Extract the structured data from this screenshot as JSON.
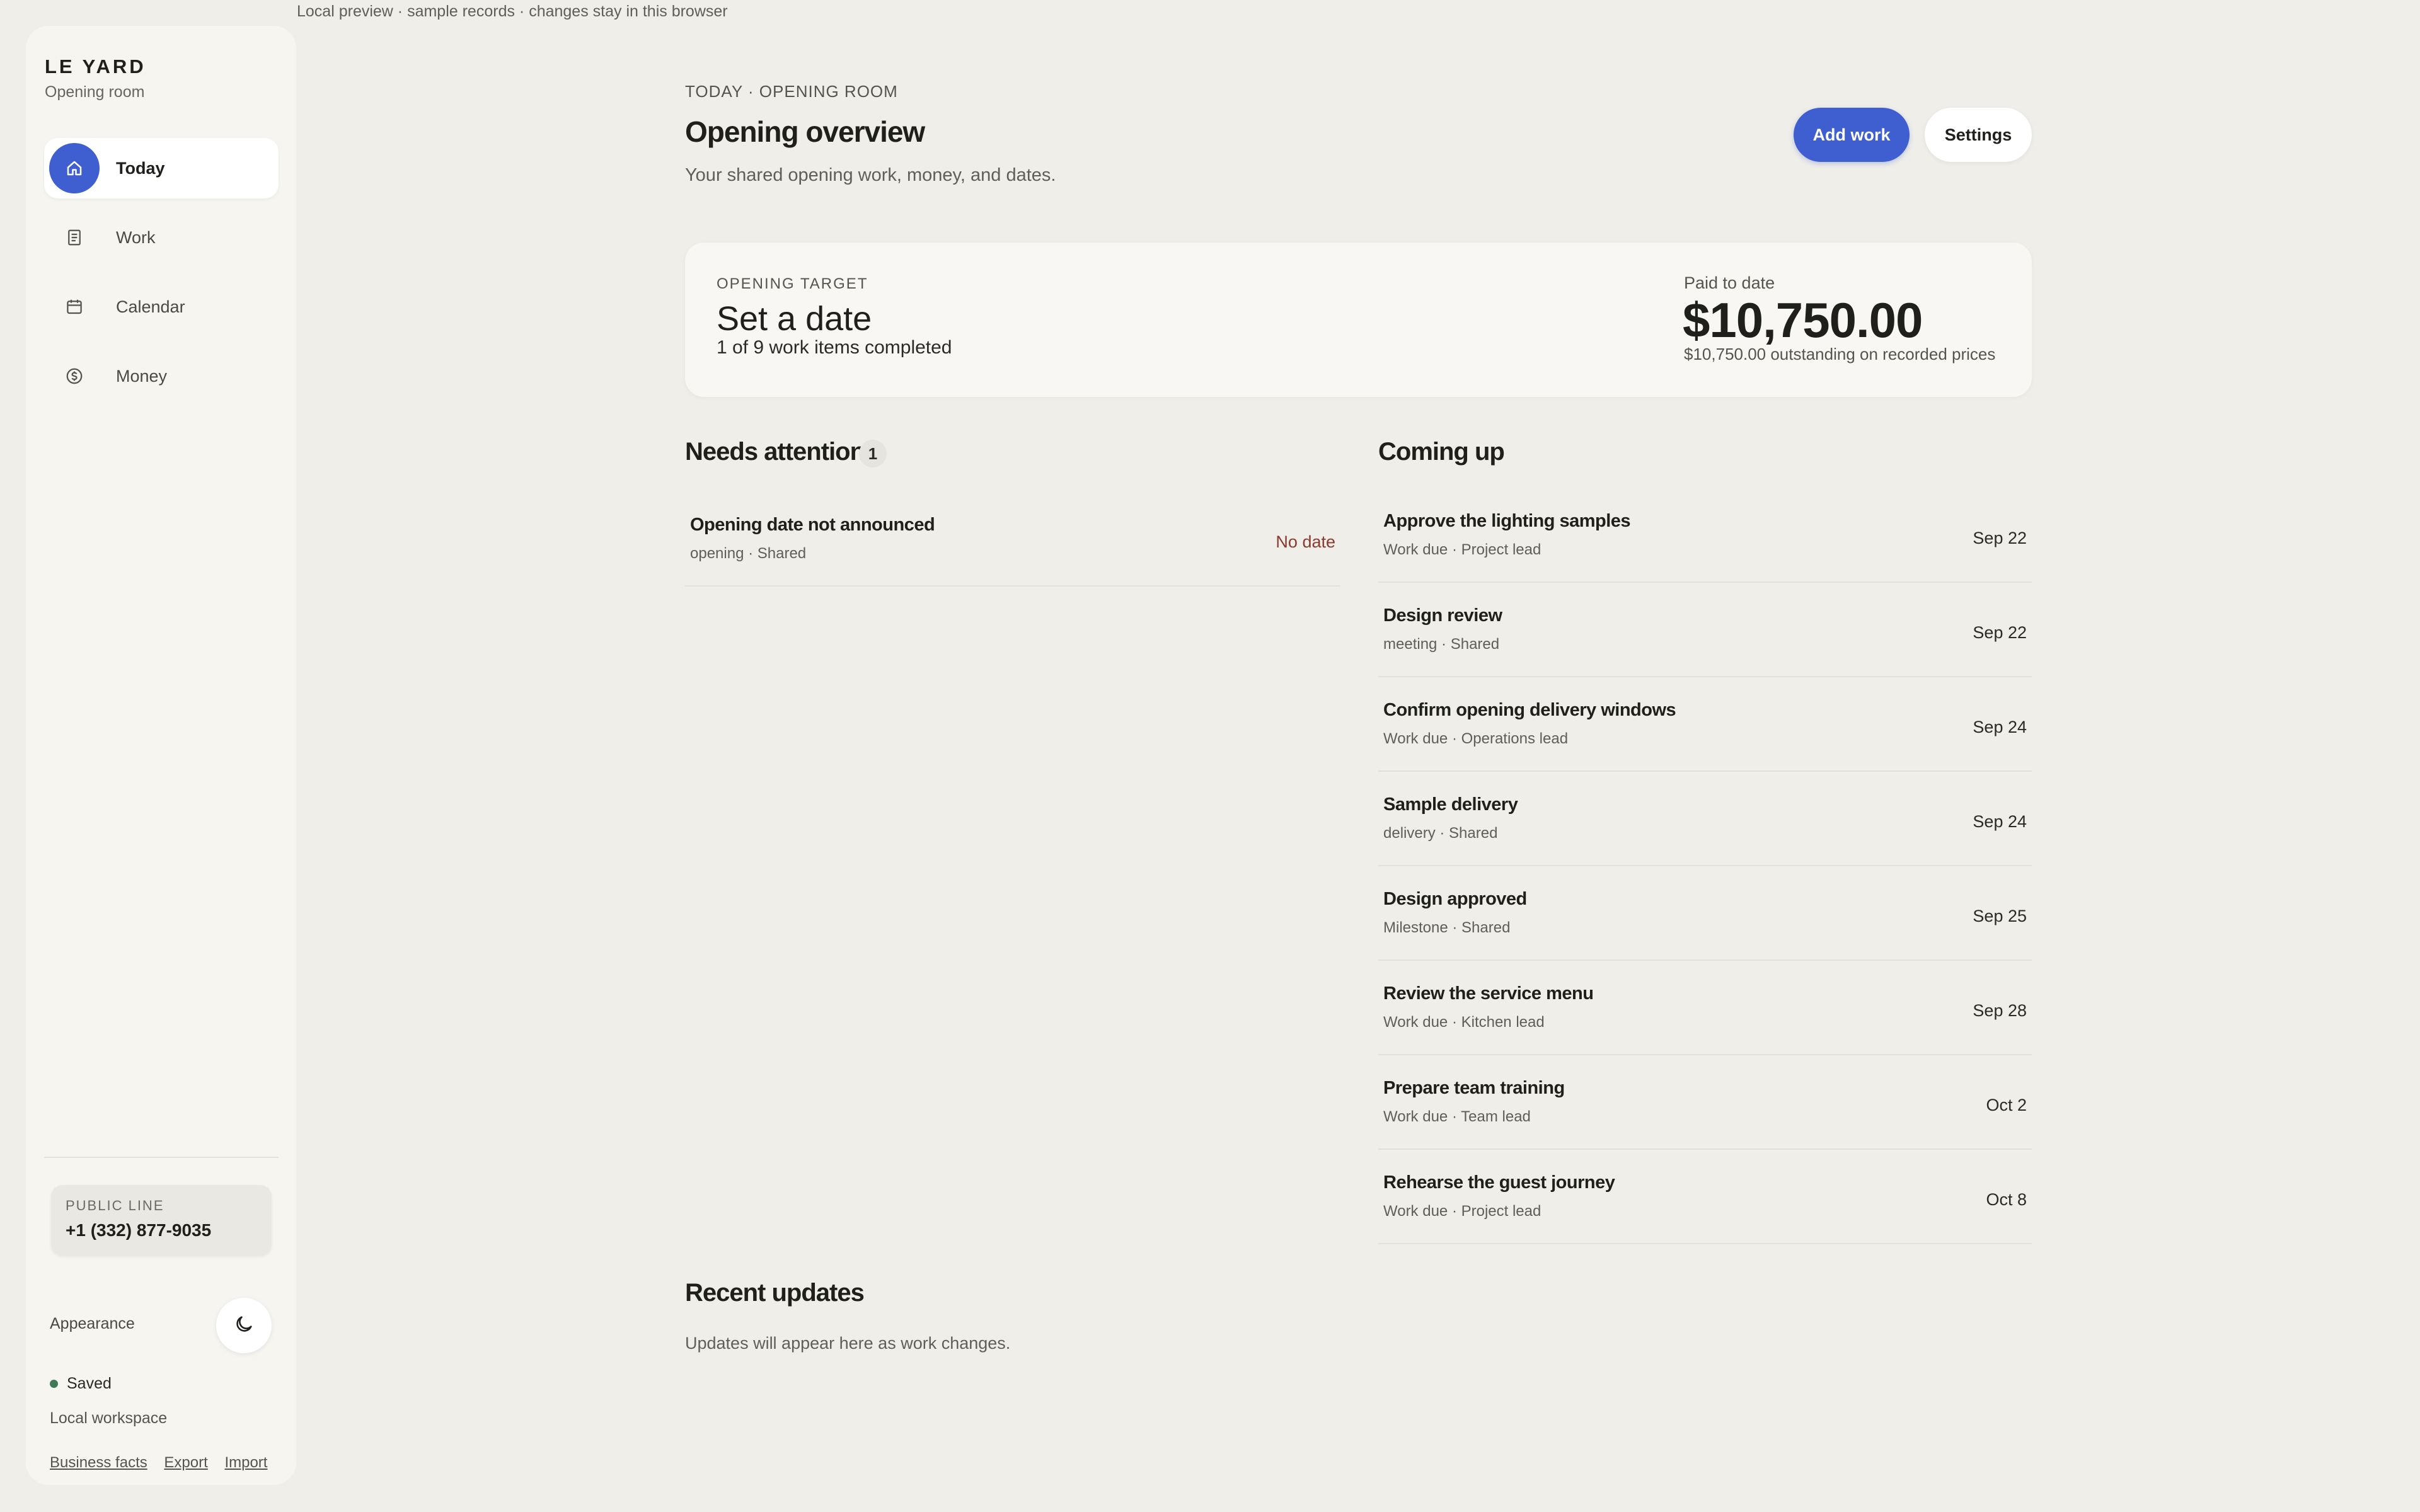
{
  "banner": "Local preview · sample records · changes stay in this browser",
  "sidebar": {
    "brand": "LE YARD",
    "brand_sub": "Opening room",
    "nav": [
      {
        "label": "Today",
        "icon": "home-icon"
      },
      {
        "label": "Work",
        "icon": "document-icon"
      },
      {
        "label": "Calendar",
        "icon": "calendar-icon"
      },
      {
        "label": "Money",
        "icon": "dollar-circle-icon"
      }
    ],
    "public_line_label": "PUBLIC LINE",
    "public_line_value": "+1 (332) 877-9035",
    "appearance_label": "Appearance",
    "appearance_icon": "moon-icon",
    "status": "Saved",
    "workspace": "Local workspace",
    "links": [
      "Business facts",
      "Export",
      "Import"
    ]
  },
  "header": {
    "eyebrow": "TODAY · OPENING ROOM",
    "title": "Opening overview",
    "subtitle": "Your shared opening work, money, and dates.",
    "add_work": "Add work",
    "settings": "Settings"
  },
  "target": {
    "label": "OPENING TARGET",
    "title": "Set a date",
    "progress": "1 of 9 work items completed",
    "paid_label": "Paid to date",
    "paid_value": "$10,750.00",
    "paid_sub": "$10,750.00 outstanding on recorded prices"
  },
  "attention": {
    "title": "Needs attention",
    "count": "1",
    "items": [
      {
        "title": "Opening date not announced",
        "meta": "opening · Shared",
        "date": "No date"
      }
    ]
  },
  "coming_up": {
    "title": "Coming up",
    "items": [
      {
        "title": "Approve the lighting samples",
        "meta": "Work due · Project lead",
        "date": "Sep 22"
      },
      {
        "title": "Design review",
        "meta": "meeting · Shared",
        "date": "Sep 22"
      },
      {
        "title": "Confirm opening delivery windows",
        "meta": "Work due · Operations lead",
        "date": "Sep 24"
      },
      {
        "title": "Sample delivery",
        "meta": "delivery · Shared",
        "date": "Sep 24"
      },
      {
        "title": "Design approved",
        "meta": "Milestone · Shared",
        "date": "Sep 25"
      },
      {
        "title": "Review the service menu",
        "meta": "Work due · Kitchen lead",
        "date": "Sep 28"
      },
      {
        "title": "Prepare team training",
        "meta": "Work due · Team lead",
        "date": "Oct 2"
      },
      {
        "title": "Rehearse the guest journey",
        "meta": "Work due · Project lead",
        "date": "Oct 8"
      }
    ]
  },
  "recent": {
    "title": "Recent updates",
    "empty": "Updates will appear here as work changes."
  },
  "colors": {
    "accent": "#3f5fd1",
    "background": "#efeee9",
    "saved_dot": "#3d7a55",
    "alert": "#8a3a2e"
  }
}
